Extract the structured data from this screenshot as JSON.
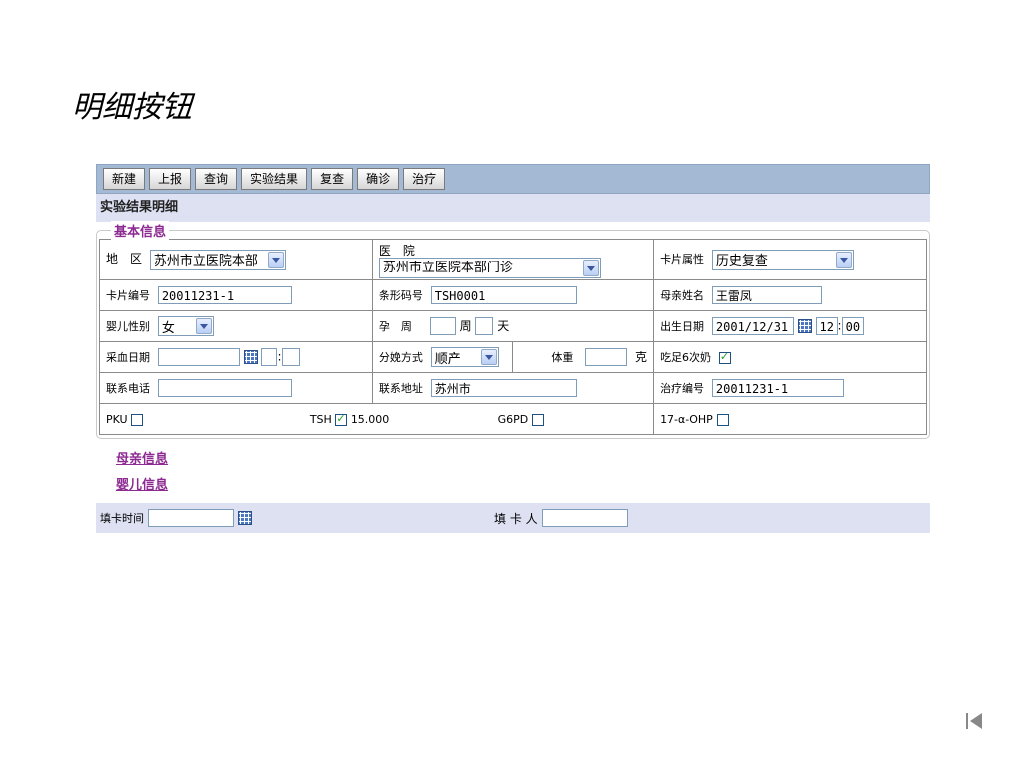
{
  "slide": {
    "title": "明细按钮"
  },
  "toolbar": {
    "buttons": [
      "新建",
      "上报",
      "查询",
      "实验结果",
      "复查",
      "确诊",
      "治疗"
    ]
  },
  "panel": {
    "title": "实验结果明细",
    "legend": "基本信息"
  },
  "row1": {
    "region_label": "地　区",
    "region_value": "苏州市立医院本部",
    "hospital_label": "医　院",
    "hospital_value": "苏州市立医院本部门诊",
    "cardattr_label": "卡片属性",
    "cardattr_value": "历史复查"
  },
  "row2": {
    "cardno_label": "卡片编号",
    "cardno_value": "20011231-1",
    "barcode_label": "条形码号",
    "barcode_value": "TSH0001",
    "mother_label": "母亲姓名",
    "mother_value": "王雷凤"
  },
  "row3": {
    "sex_label": "婴儿性别",
    "sex_value": "女",
    "preg_label": "孕　周",
    "week_unit": "周",
    "day_unit": "天",
    "birth_label": "出生日期",
    "birth_date": "2001/12/31",
    "birth_hour": "12",
    "birth_min": "00"
  },
  "row4": {
    "blood_label": "采血日期",
    "blood_date": "",
    "time_sep": ":",
    "delivery_label": "分娩方式",
    "delivery_value": "顺产",
    "weight_label": "体重",
    "weight_unit": "克",
    "feed_label": "吃足6次奶"
  },
  "row5": {
    "phone_label": "联系电话",
    "phone_value": "",
    "address_label": "联系地址",
    "address_value": "苏州市",
    "treat_label": "治疗编号",
    "treat_value": "20011231-1"
  },
  "row6": {
    "pku_label": "PKU",
    "tsh_label": "TSH",
    "tsh_value": "15.000",
    "g6pd_label": "G6PD",
    "ohp_label": "17-α-OHP"
  },
  "links": {
    "mother_info": "母亲信息",
    "baby_info": "婴儿信息"
  },
  "footer": {
    "fill_time_label": "填卡时间",
    "filler_label": "填 卡 人"
  }
}
